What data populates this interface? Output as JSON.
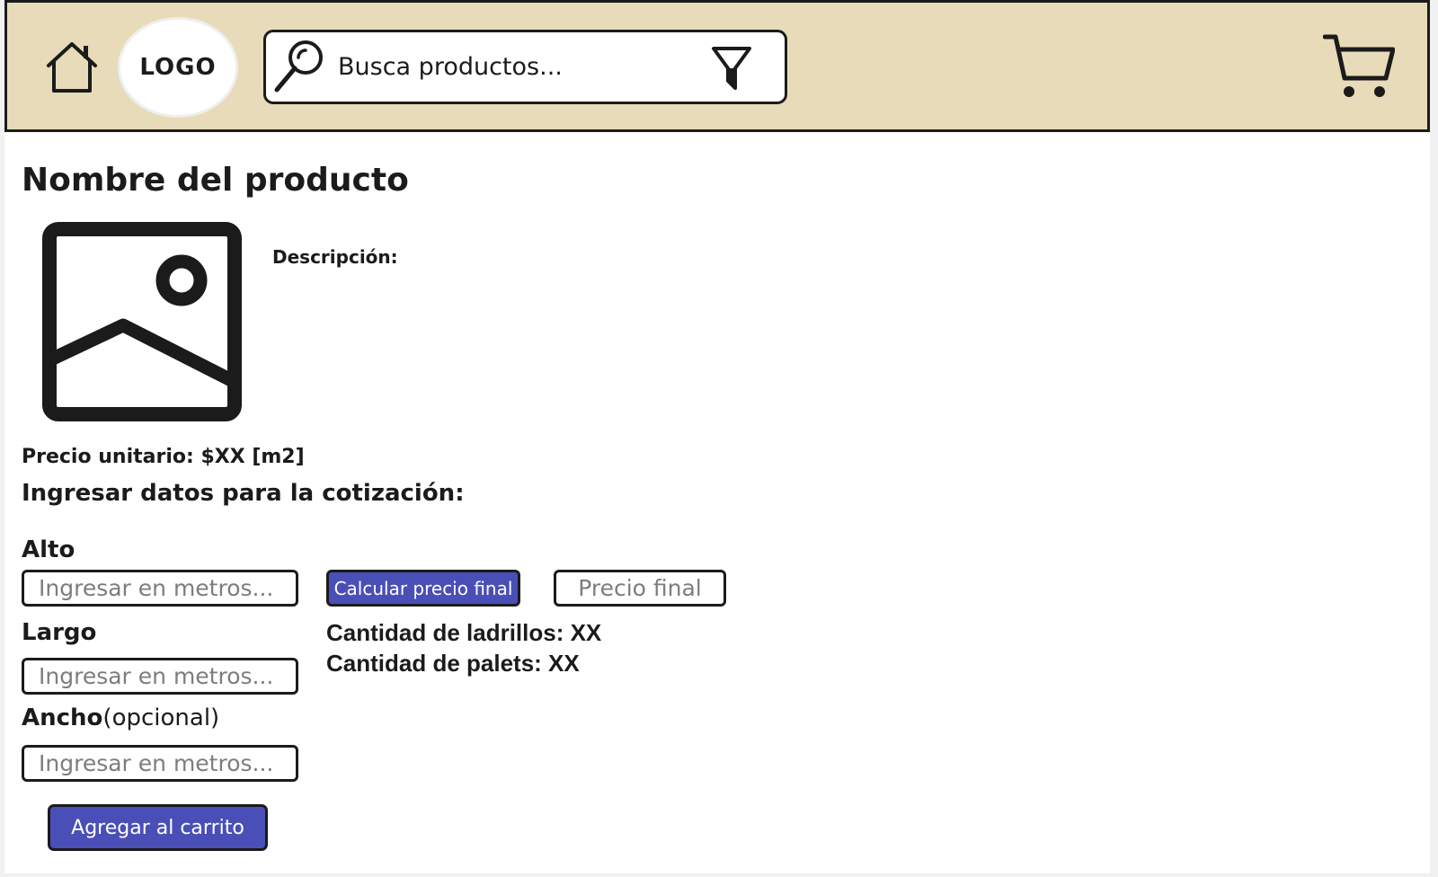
{
  "header": {
    "logo_text": "LOGO",
    "search": {
      "placeholder": "Busca productos..."
    },
    "icons": {
      "home": "home-icon",
      "search": "search-icon",
      "filter": "filter-icon",
      "cart": "cart-icon"
    },
    "background_color": "#e7dbb9"
  },
  "product": {
    "title": "Nombre del producto",
    "image_icon": "image-placeholder-icon",
    "description_label": "Descripción:",
    "unit_price": "Precio unitario: $XX [m2]"
  },
  "quote": {
    "heading": "Ingresar datos para la cotización:",
    "fields": [
      {
        "label": "Alto",
        "optional_note": "",
        "placeholder": "Ingresar en metros..."
      },
      {
        "label": "Largo",
        "optional_note": "",
        "placeholder": "Ingresar en metros..."
      },
      {
        "label": "Ancho",
        "optional_note": "(opcional)",
        "placeholder": "Ingresar en metros..."
      }
    ],
    "calculate_label": "Calcular precio final",
    "final_price_placeholder": "Precio final",
    "bricks_count": "Cantidad de ladrillos: XX",
    "pallets_count": "Cantidad de palets: XX",
    "add_to_cart_label": "Agregar al carrito"
  },
  "colors": {
    "accent": "#4a4fb7",
    "border": "#1b1b1b",
    "placeholder_text": "#7d7d7d"
  }
}
